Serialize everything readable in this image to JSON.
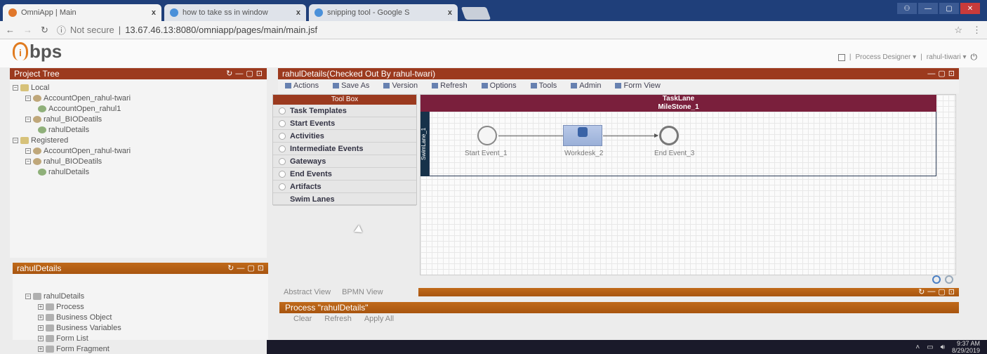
{
  "browser": {
    "tabs": [
      {
        "title": "OmniApp | Main",
        "icon": "omniapp-favicon",
        "color": "#e0772b"
      },
      {
        "title": "how to take ss in window",
        "icon": "google-favicon",
        "color": "#4a90d9"
      },
      {
        "title": "snipping tool - Google S",
        "icon": "google-favicon",
        "color": "#4a90d9"
      }
    ],
    "close_glyph": "x",
    "security": "Not secure",
    "url": "13.67.46.13:8080/omniapp/pages/main/main.jsf"
  },
  "app": {
    "logo_text": "bps",
    "header_links": [
      "Process Designer ▾",
      "rahul-tiwari ▾"
    ],
    "accent": "#9c3a1e"
  },
  "project_tree": {
    "title": "Project Tree",
    "items": [
      {
        "label": "Local",
        "depth": 0,
        "icon": "folder-icon"
      },
      {
        "label": "AccountOpen_rahul-twari",
        "depth": 1,
        "icon": "project-icon"
      },
      {
        "label": "AccountOpen_rahul1",
        "depth": 2,
        "icon": "process-icon"
      },
      {
        "label": "rahul_BIODeatils",
        "depth": 1,
        "icon": "project-icon"
      },
      {
        "label": "rahulDetails",
        "depth": 2,
        "icon": "process-icon"
      },
      {
        "label": "Registered",
        "depth": 0,
        "icon": "folder-icon"
      },
      {
        "label": "AccountOpen_rahul-twari",
        "depth": 1,
        "icon": "project-icon"
      },
      {
        "label": "rahul_BIODeatils",
        "depth": 1,
        "icon": "project-icon"
      },
      {
        "label": "rahulDetails",
        "depth": 2,
        "icon": "process-icon"
      }
    ]
  },
  "details_panel": {
    "title": "rahulDetails",
    "items": [
      {
        "label": "rahulDetails",
        "depth": 0
      },
      {
        "label": "Process",
        "depth": 1
      },
      {
        "label": "Business Object",
        "depth": 1
      },
      {
        "label": "Business Variables",
        "depth": 1
      },
      {
        "label": "Form List",
        "depth": 1
      },
      {
        "label": "Form Fragment",
        "depth": 1
      }
    ]
  },
  "designer": {
    "title": "rahulDetails(Checked Out By rahul-twari)",
    "toolbar": [
      "Actions",
      "Save As",
      "Version",
      "Refresh",
      "Options",
      "Tools",
      "Admin",
      "Form View"
    ],
    "toolbox_title": "Tool Box",
    "toolbox_items": [
      "Task Templates",
      "Start Events",
      "Activities",
      "Intermediate Events",
      "Gateways",
      "End Events",
      "Artifacts",
      "Swim Lanes"
    ],
    "lane_title": "TaskLane",
    "milestone": "MileStone_1",
    "swimlane": "SwimLane_1",
    "nodes": {
      "start": "Start Event_1",
      "workdesk": "Workdesk_2",
      "end": "End Event_3"
    }
  },
  "bottom": {
    "view_tabs": [
      "Abstract View",
      "BPMN View"
    ],
    "process_title": "Process \"rahulDetails\"",
    "buttons": [
      "Clear",
      "Refresh",
      "Apply All"
    ]
  },
  "taskbar": {
    "time": "9:37 AM",
    "date": "8/29/2019"
  }
}
